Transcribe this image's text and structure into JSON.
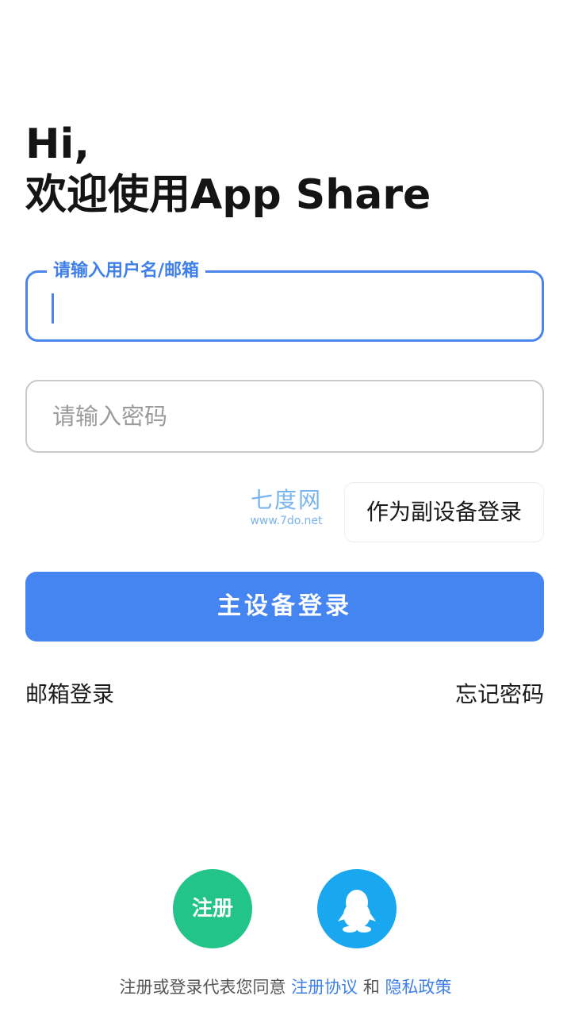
{
  "greeting": {
    "line1": "Hi,",
    "line2": "欢迎使用App Share"
  },
  "username_field": {
    "label": "请输入用户名/邮箱",
    "value": ""
  },
  "password_field": {
    "placeholder": "请输入密码",
    "value": ""
  },
  "watermark": {
    "name": "七度网",
    "url": "www.7do.net"
  },
  "buttons": {
    "secondary_login": "作为副设备登录",
    "primary_login": "主设备登录",
    "register": "注册"
  },
  "links": {
    "email_login": "邮箱登录",
    "forgot_password": "忘记密码"
  },
  "icons": {
    "qq_login": "qq-penguin-icon"
  },
  "terms": {
    "prefix": "注册或登录代表您同意 ",
    "agreement": "注册协议",
    "and": " 和 ",
    "privacy": "隐私政策"
  },
  "colors": {
    "accent": "#4585f2",
    "register": "#22c48a",
    "qq": "#19a8f0"
  }
}
